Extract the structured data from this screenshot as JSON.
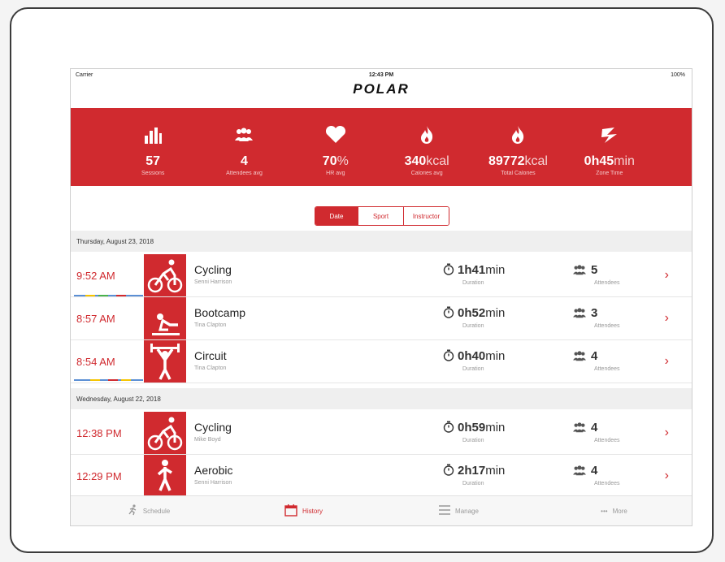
{
  "status_bar": {
    "carrier": "Carrier",
    "time": "12:43 PM",
    "battery": "100%"
  },
  "brand": {
    "logo": "POLAR",
    "color": "#d02a2f"
  },
  "stats": [
    {
      "icon": "bar-chart-icon",
      "value": "57",
      "unit": "",
      "label": "Sessions"
    },
    {
      "icon": "people-icon",
      "value": "4",
      "unit": "",
      "label": "Attendees avg"
    },
    {
      "icon": "heart-icon",
      "value": "70",
      "unit": "%",
      "label": "HR avg"
    },
    {
      "icon": "flame-icon",
      "value": "340",
      "unit": "kcal",
      "label": "Calories avg"
    },
    {
      "icon": "flame-icon",
      "value": "89772",
      "unit": "kcal",
      "label": "Total Calories"
    },
    {
      "icon": "zone-icon",
      "value": "0h45",
      "unit": "min",
      "label": "Zone Time"
    }
  ],
  "segment": {
    "options": [
      "Date",
      "Sport",
      "Instructor"
    ],
    "selected": "Date"
  },
  "days": [
    {
      "date": "Thursday, August 23, 2018",
      "sessions": [
        {
          "time": "9:52 AM",
          "sport": "Cycling",
          "sport_icon": "cycling-icon",
          "instructor": "Senni Harrison",
          "dur_h": "1h",
          "dur_m": "41",
          "dur_u": "min",
          "duration_label": "Duration",
          "attendees": "5",
          "attendees_label": "Attendees"
        },
        {
          "time": "8:57 AM",
          "sport": "Bootcamp",
          "sport_icon": "bootcamp-icon",
          "instructor": "Tina Clapton",
          "dur_h": "0h",
          "dur_m": "52",
          "dur_u": "min",
          "duration_label": "Duration",
          "attendees": "3",
          "attendees_label": "Attendees"
        },
        {
          "time": "8:54 AM",
          "sport": "Circuit",
          "sport_icon": "circuit-icon",
          "instructor": "Tina Clapton",
          "dur_h": "0h",
          "dur_m": "40",
          "dur_u": "min",
          "duration_label": "Duration",
          "attendees": "4",
          "attendees_label": "Attendees"
        }
      ]
    },
    {
      "date": "Wednesday, August 22, 2018",
      "sessions": [
        {
          "time": "12:38 PM",
          "sport": "Cycling",
          "sport_icon": "cycling-icon",
          "instructor": "Mike Boyd",
          "dur_h": "0h",
          "dur_m": "59",
          "dur_u": "min",
          "duration_label": "Duration",
          "attendees": "4",
          "attendees_label": "Attendees"
        },
        {
          "time": "12:29 PM",
          "sport": "Aerobic",
          "sport_icon": "aerobic-icon",
          "instructor": "Senni Harrison",
          "dur_h": "2h",
          "dur_m": "17",
          "dur_u": "min",
          "duration_label": "Duration",
          "attendees": "4",
          "attendees_label": "Attendees"
        }
      ]
    }
  ],
  "tabs": [
    {
      "label": "Schedule",
      "icon": "runner-icon",
      "active": false
    },
    {
      "label": "History",
      "icon": "calendar-icon",
      "active": true
    },
    {
      "label": "Manage",
      "icon": "list-icon",
      "active": false
    },
    {
      "label": "More",
      "icon": "more-icon",
      "active": false
    }
  ]
}
